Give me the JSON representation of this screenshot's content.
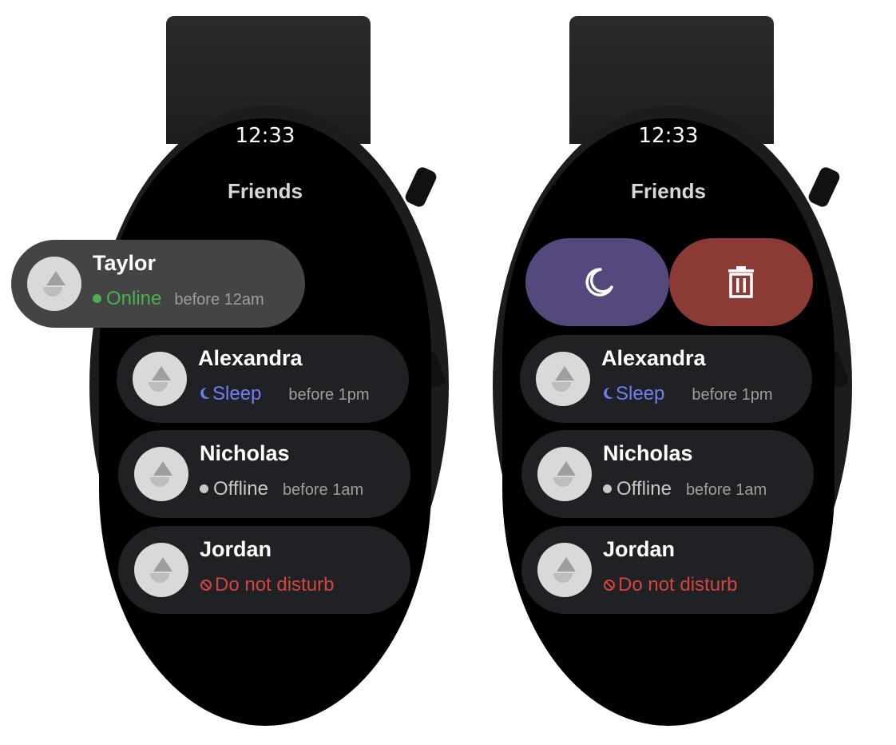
{
  "frames": [
    {
      "time": "12:33",
      "title": "Friends",
      "friends": [
        {
          "name": "Taylor",
          "status": "Online",
          "when": "before 12am"
        },
        {
          "name": "Alexandra",
          "status": "Sleep",
          "when": "before 1pm"
        },
        {
          "name": "Nicholas",
          "status": "Offline",
          "when": "before 1am"
        },
        {
          "name": "Jordan",
          "status": "Do not disturb",
          "when": ""
        }
      ]
    },
    {
      "time": "12:33",
      "title": "Friends",
      "actions": [
        {
          "icon": "moon-icon",
          "color": "#54487d"
        },
        {
          "icon": "trash-icon",
          "color": "#8c3a36"
        }
      ],
      "friends": [
        {
          "name": "Alexandra",
          "status": "Sleep",
          "when": "before 1pm"
        },
        {
          "name": "Nicholas",
          "status": "Offline",
          "when": "before 1am"
        },
        {
          "name": "Jordan",
          "status": "Do not disturb",
          "when": ""
        }
      ]
    }
  ],
  "colors": {
    "online": "#4caf50",
    "sleep": "#6c7ff2",
    "offline": "#c8c8c8",
    "dnd": "#d2453e",
    "card": "#202124",
    "card_swiped": "#444444"
  }
}
